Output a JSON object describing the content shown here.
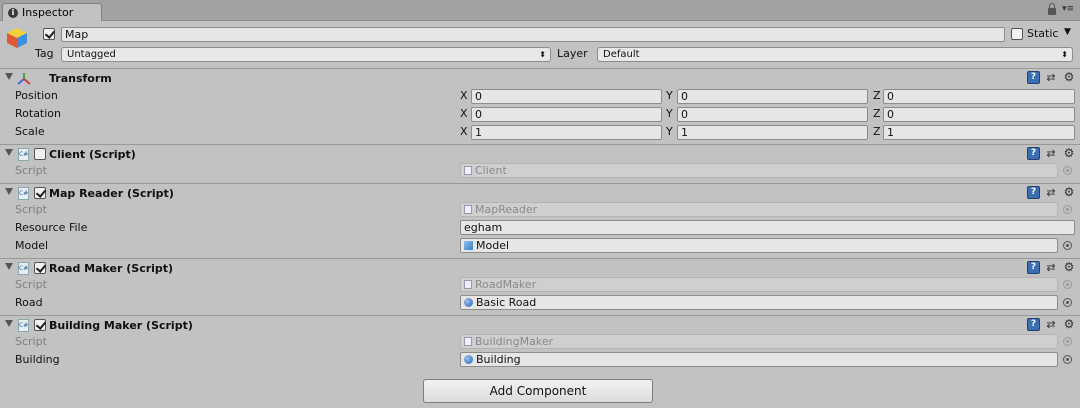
{
  "tab": {
    "title": "Inspector"
  },
  "gameobject": {
    "name": "Map",
    "static_label": "Static",
    "tag_label": "Tag",
    "tag_value": "Untagged",
    "layer_label": "Layer",
    "layer_value": "Default"
  },
  "transform": {
    "title": "Transform",
    "rows": [
      {
        "label": "Position",
        "x": "0",
        "y": "0",
        "z": "0"
      },
      {
        "label": "Rotation",
        "x": "0",
        "y": "0",
        "z": "0"
      },
      {
        "label": "Scale",
        "x": "1",
        "y": "1",
        "z": "1"
      }
    ],
    "axes": [
      "X",
      "Y",
      "Z"
    ]
  },
  "components": [
    {
      "title": "Client (Script)",
      "enabled": false,
      "script_label": "Script",
      "script_value": "Client"
    },
    {
      "title": "Map Reader (Script)",
      "enabled": true,
      "script_label": "Script",
      "script_value": "MapReader",
      "fields": [
        {
          "label": "Resource File",
          "value": "egham"
        },
        {
          "label": "Model",
          "value": "Model"
        }
      ]
    },
    {
      "title": "Road Maker (Script)",
      "enabled": true,
      "script_label": "Script",
      "script_value": "RoadMaker",
      "fields": [
        {
          "label": "Road",
          "value": "Basic Road"
        }
      ]
    },
    {
      "title": "Building Maker (Script)",
      "enabled": true,
      "script_label": "Script",
      "script_value": "BuildingMaker",
      "fields": [
        {
          "label": "Building",
          "value": "Building"
        }
      ]
    }
  ],
  "add_component": "Add Component",
  "colors": {
    "background": "#c2c2c2",
    "help_icon": "#3c6fb1"
  }
}
